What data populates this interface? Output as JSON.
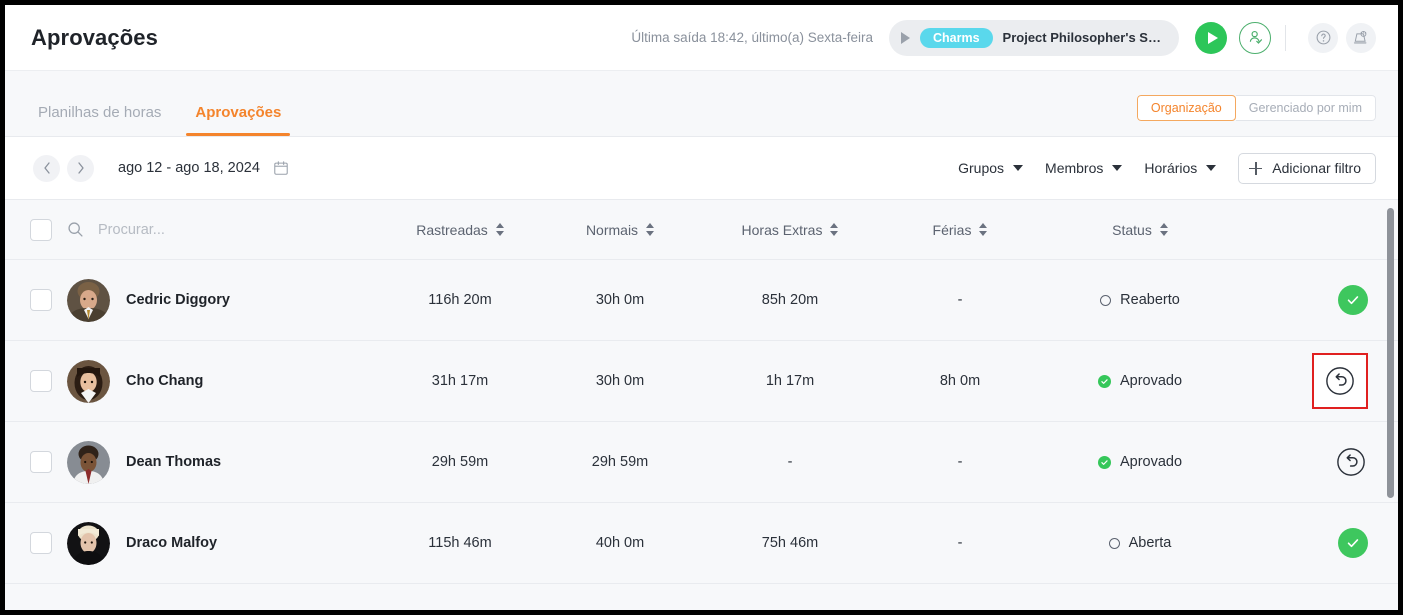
{
  "header": {
    "title": "Aprovações",
    "last_exit": "Última saída 18:42, último(a) Sexta-feira",
    "timer": {
      "tag": "Charms",
      "project": "Project Philosopher's St..."
    },
    "icons": {
      "play_small": "play-triangle-icon",
      "start_timer": "play-button-icon",
      "user_check": "user-check-icon",
      "help": "help-circle-icon",
      "whats_new": "megaphone-icon"
    }
  },
  "tabs": {
    "items": [
      {
        "label": "Planilhas de horas",
        "active": false
      },
      {
        "label": "Aprovações",
        "active": true
      }
    ],
    "scope_toggle": {
      "options": [
        "Organização",
        "Gerenciado por mim"
      ],
      "selected": "Organização"
    }
  },
  "filters": {
    "date_range": "ago 12 - ago 18, 2024",
    "prev_label": "‹",
    "next_label": "›",
    "calendar_icon": "calendar-icon",
    "dropdowns": [
      "Grupos",
      "Membros",
      "Horários"
    ],
    "add_filter": "Adicionar filtro"
  },
  "table": {
    "search_placeholder": "Procurar...",
    "columns": [
      {
        "key": "tracked",
        "label": "Rastreadas"
      },
      {
        "key": "regular",
        "label": "Normais"
      },
      {
        "key": "overtime",
        "label": "Horas Extras"
      },
      {
        "key": "timeoff",
        "label": "Férias"
      },
      {
        "key": "status",
        "label": "Status"
      }
    ],
    "rows": [
      {
        "name": "Cedric Diggory",
        "tracked": "116h 20m",
        "regular": "30h 0m",
        "overtime": "85h 20m",
        "timeoff": "-",
        "status": "Reaberto",
        "status_type": "open",
        "action": "approve",
        "highlighted": false,
        "avatar_colors": [
          "#6b5a48",
          "#c9a882",
          "#3c3026"
        ]
      },
      {
        "name": "Cho Chang",
        "tracked": "31h 17m",
        "regular": "30h 0m",
        "overtime": "1h 17m",
        "timeoff": "8h 0m",
        "status": "Aprovado",
        "status_type": "approved",
        "action": "undo",
        "highlighted": true,
        "avatar_colors": [
          "#5a3d28",
          "#e0b89a",
          "#2a1a10"
        ]
      },
      {
        "name": "Dean Thomas",
        "tracked": "29h 59m",
        "regular": "29h 59m",
        "overtime": "-",
        "timeoff": "-",
        "status": "Aprovado",
        "status_type": "approved",
        "action": "undo",
        "highlighted": false,
        "avatar_colors": [
          "#7e838a",
          "#6b4a33",
          "#43362a"
        ]
      },
      {
        "name": "Draco Malfoy",
        "tracked": "115h 46m",
        "regular": "40h 0m",
        "overtime": "75h 46m",
        "timeoff": "-",
        "status": "Aberta",
        "status_type": "open",
        "action": "approve",
        "highlighted": false,
        "avatar_colors": [
          "#1a1a1c",
          "#e6dcc8",
          "#0d0d0f"
        ]
      }
    ]
  },
  "colors": {
    "accent": "#f4842c",
    "approve_green": "#3ec75e",
    "chip_cyan": "#5ad8ec",
    "highlight_red": "#e02020",
    "page_bg": "#f7f8fa"
  }
}
